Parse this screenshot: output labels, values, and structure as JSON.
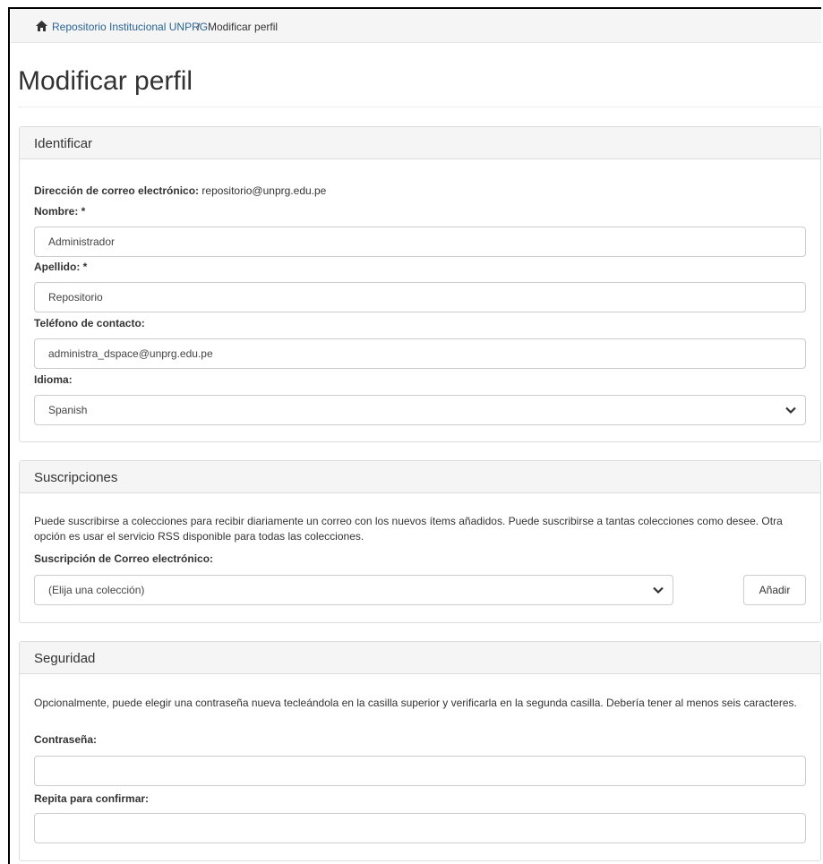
{
  "breadcrumb": {
    "home_link": "Repositorio Institucional UNPRG",
    "separator": "/",
    "current": "Modificar perfil"
  },
  "page_title": "Modificar perfil",
  "identify": {
    "heading": "Identificar",
    "email_label": "Dirección de correo electrónico:",
    "email_value": "repositorio@unprg.edu.pe",
    "first_name_label": "Nombre: *",
    "first_name_value": "Administrador",
    "last_name_label": "Apellido: *",
    "last_name_value": "Repositorio",
    "phone_label": "Teléfono de contacto:",
    "phone_value": "administra_dspace@unprg.edu.pe",
    "language_label": "Idioma:",
    "language_value": "Spanish"
  },
  "subscriptions": {
    "heading": "Suscripciones",
    "description": "Puede suscribirse a colecciones para recibir diariamente un correo con los nuevos ítems añadidos. Puede suscribirse a tantas colecciones como desee. Otra opción es usar el servicio RSS disponible para todas las colecciones.",
    "email_sub_label": "Suscripción de Correo electrónico:",
    "collection_select_value": "(Elija una colección)",
    "add_button": "Añadir"
  },
  "security": {
    "heading": "Seguridad",
    "description": "Opcionalmente, puede elegir una contraseña nueva tecleándola en la casilla superior y verificarla en la segunda casilla. Debería tener al menos seis caracteres.",
    "password_label": "Contraseña:",
    "password_value": "",
    "confirm_label": "Repita para confirmar:",
    "confirm_value": ""
  },
  "colors": {
    "link": "#2a6496",
    "panel_heading_bg": "#f5f5f5",
    "border": "#dddddd"
  },
  "icons": {
    "home": "home-icon",
    "select_arrow": "chevron-down-icon"
  }
}
